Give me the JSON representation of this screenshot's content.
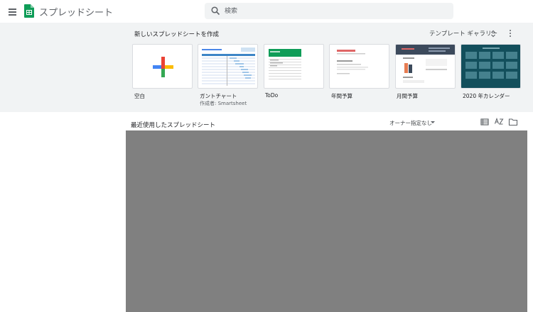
{
  "app": {
    "title": "スプレッドシート"
  },
  "search": {
    "placeholder": "検索"
  },
  "templates": {
    "heading": "新しいスプレッドシートを作成",
    "gallery_label": "テンプレート ギャラリー",
    "items": [
      {
        "label": "空白",
        "sub": ""
      },
      {
        "label": "ガントチャート",
        "sub": "作成者: Smartsheet"
      },
      {
        "label": "ToDo",
        "sub": ""
      },
      {
        "label": "年間予算",
        "sub": ""
      },
      {
        "label": "月間予算",
        "sub": ""
      },
      {
        "label": "2020 年カレンダー",
        "sub": ""
      }
    ]
  },
  "recent": {
    "title": "最近使用したスプレッドシート",
    "owner_filter": "オーナー指定なし"
  },
  "colors": {
    "brand_green": "#0f9d58",
    "google_blue": "#4285f4",
    "google_red": "#ea4335",
    "google_yellow": "#fbbc04",
    "google_green": "#34a853",
    "band_bg": "#f1f3f4",
    "content_gray": "#808080"
  }
}
